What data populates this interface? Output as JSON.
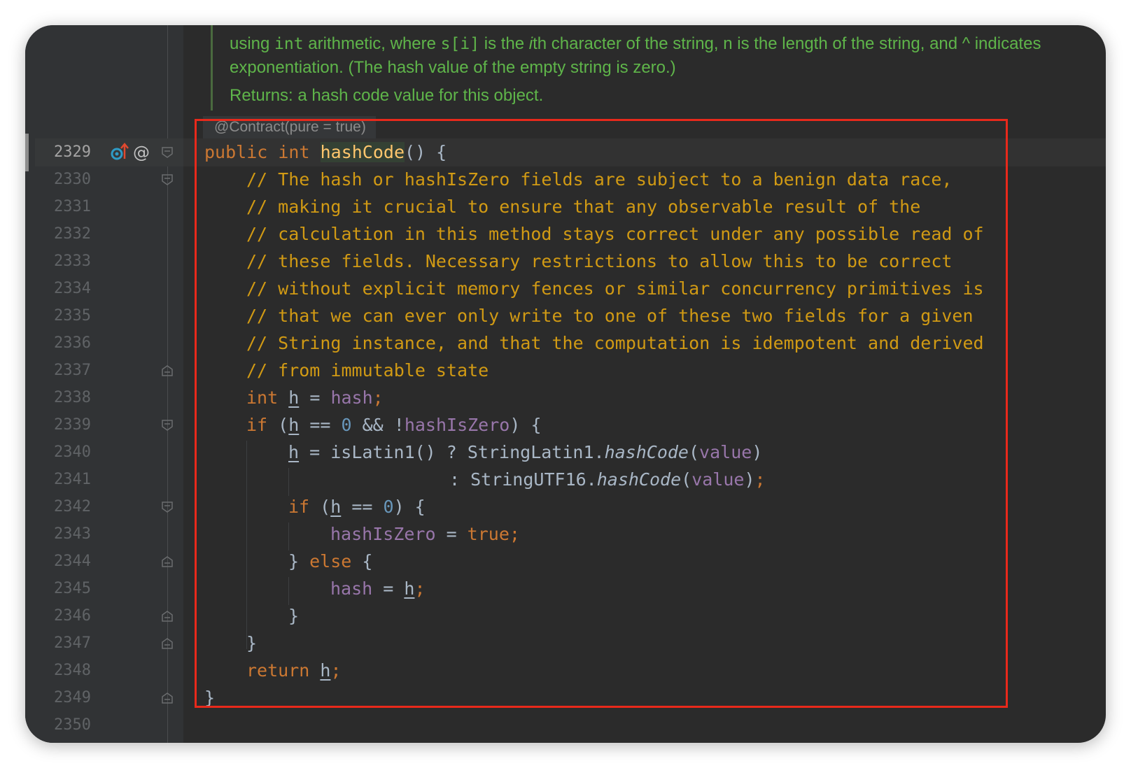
{
  "doc": {
    "line1_pre": "using ",
    "line1_code1": "int",
    "line1_mid": " arithmetic, where ",
    "line1_code2": "s[i]",
    "line1_mid2": " is the ",
    "line1_em": "i",
    "line1_post": "th character of the string, n is the length of the string, and ^ indicates",
    "line2": "exponentiation. (The hash value of the empty string is zero.)",
    "returns": "Returns:  a hash code value for this object."
  },
  "annotation": "@Contract(pure = true)",
  "gutter_icons": {
    "override": "override-up-arrow-icon",
    "at": "@"
  },
  "lines": [
    {
      "num": "2329"
    },
    {
      "num": "2330"
    },
    {
      "num": "2331"
    },
    {
      "num": "2332"
    },
    {
      "num": "2333"
    },
    {
      "num": "2334"
    },
    {
      "num": "2335"
    },
    {
      "num": "2336"
    },
    {
      "num": "2337"
    },
    {
      "num": "2338"
    },
    {
      "num": "2339"
    },
    {
      "num": "2340"
    },
    {
      "num": "2341"
    },
    {
      "num": "2342"
    },
    {
      "num": "2343"
    },
    {
      "num": "2344"
    },
    {
      "num": "2345"
    },
    {
      "num": "2346"
    },
    {
      "num": "2347"
    },
    {
      "num": "2348"
    },
    {
      "num": "2349"
    },
    {
      "num": "2350"
    }
  ],
  "code": {
    "l2329": {
      "kw1": "public",
      "kw2": "int",
      "fn": "hashCode",
      "rest": "() {"
    },
    "l2330": "// The hash or hashIsZero fields are subject to a benign data race,",
    "l2331": "// making it crucial to ensure that any observable result of the",
    "l2332": "// calculation in this method stays correct under any possible read of",
    "l2333": "// these fields. Necessary restrictions to allow this to be correct",
    "l2334": "// without explicit memory fences or similar concurrency primitives is",
    "l2335": "// that we can ever only write to one of these two fields for a given",
    "l2336": "// String instance, and that the computation is idempotent and derived",
    "l2337": "// from immutable state",
    "l2338": {
      "kw": "int",
      "var": "h",
      "op": " = ",
      "field": "hash",
      "semi": ";"
    },
    "l2339": {
      "kw": "if",
      "p1": " (",
      "var": "h",
      "op": " == ",
      "num": "0",
      "op2": " && !",
      "field": "hashIsZero",
      "rest": ") {"
    },
    "l2340": {
      "var": "h",
      "p1": " = isLatin1() ? StringLatin1.",
      "it": "hashCode",
      "p2": "(",
      "field": "value",
      "p3": ")"
    },
    "l2341": {
      "p1": ": StringUTF16.",
      "it": "hashCode",
      "p2": "(",
      "field": "value",
      "p3": ")",
      "semi": ";"
    },
    "l2342": {
      "kw": "if",
      "p1": " (",
      "var": "h",
      "op": " == ",
      "num": "0",
      "rest": ") {"
    },
    "l2343": {
      "field": "hashIsZero",
      "op": " = ",
      "kw": "true",
      "semi": ";"
    },
    "l2344": {
      "p1": "} ",
      "kw": "else",
      "rest": " {"
    },
    "l2345": {
      "field": "hash",
      "op": " = ",
      "var": "h",
      "semi": ";"
    },
    "l2346": "}",
    "l2347": "}",
    "l2348": {
      "kw": "return",
      "var": "h",
      "semi": ";"
    },
    "l2349": "}"
  },
  "colors": {
    "highlight_box": "#e8291b",
    "keyword": "#cc7832",
    "comment": "#d19a14",
    "field": "#9876aa",
    "number": "#6897bb",
    "doc_text": "#5fb54a"
  }
}
